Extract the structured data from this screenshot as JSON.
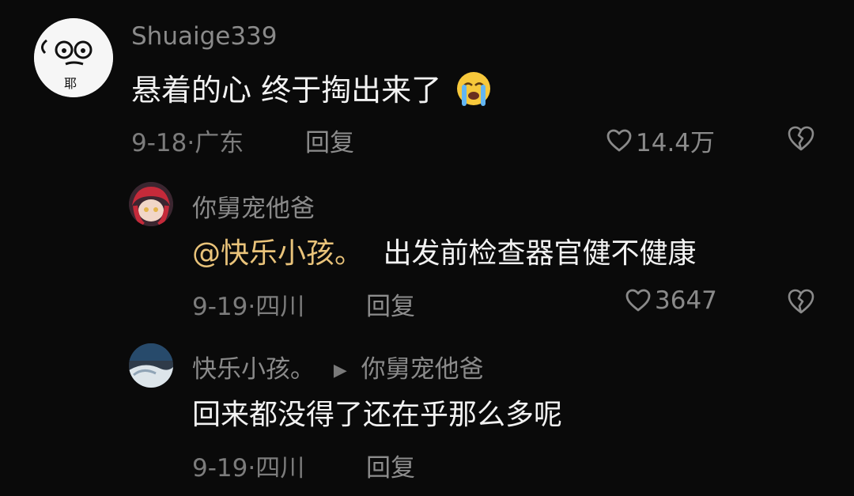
{
  "comments": [
    {
      "username": "Shuaige339",
      "text": "悬着的心 终于掏出来了",
      "emoji": "loudly-crying-face",
      "date": "9-18",
      "location": "广东",
      "reply_label": "回复",
      "likes": "14.4万"
    },
    {
      "username": "你舅宠他爸",
      "mention": "@快乐小孩。",
      "text": "出发前检查器官健不健康",
      "date": "9-19",
      "location": "四川",
      "reply_label": "回复",
      "likes": "3647"
    },
    {
      "username": "快乐小孩。",
      "reply_to": "你舅宠他爸",
      "text": "回来都没得了还在乎那么多呢",
      "date": "9-19",
      "location": "四川",
      "reply_label": "回复"
    }
  ],
  "icons": {
    "like": "heart-outline-icon",
    "dislike": "broken-heart-icon",
    "reply_arrow": "triangle-right-icon"
  },
  "colors": {
    "background": "#0a0a0a",
    "mention": "#e9c37a",
    "text": "#f2f2f2",
    "muted": "#8a8a8a"
  }
}
